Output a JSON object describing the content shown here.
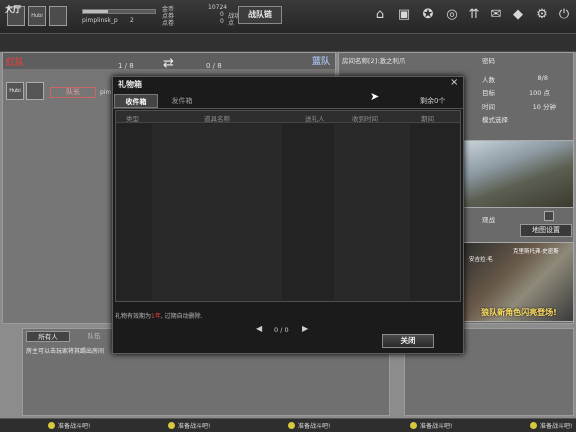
{
  "topbar": {
    "avatar_text": "Hubi",
    "player_name": "pimplinsk_p",
    "level": "2",
    "xp_percent": 0.35,
    "stats_left": [
      "金币",
      "点券",
      "点卷"
    ],
    "stats_right_values": [
      "10724",
      "0",
      "0"
    ],
    "stats_right_labels": [
      "",
      "战功",
      "点"
    ],
    "battle_button": "战队链"
  },
  "hall": {
    "title": "大厅"
  },
  "teams": {
    "red_label": "红队",
    "red_count": "1 / 8",
    "blue_label": "蓝队",
    "blue_count": "0 / 8",
    "slot_avatar": "Hubi",
    "slot_rank": "队长",
    "slot_name": "pim"
  },
  "room": {
    "room_name": "房间名称[2]:激之利爪",
    "password_label": "密码",
    "rows": [
      {
        "label": "人数",
        "value": "8/8"
      },
      {
        "label": "目标",
        "value": "100 点"
      },
      {
        "label": "时间",
        "value": "10 分钟"
      },
      {
        "label": "模式选择",
        "value": ""
      }
    ],
    "observe_label": "观战",
    "map_button": "地图设置"
  },
  "ad": {
    "top_text": "克里斯托弗·史密斯",
    "side_text": "安吉拉·毛",
    "headline": "狼队新角色闪亮登场!"
  },
  "chat": {
    "tab_all": "所有人",
    "tab_team": "队伍",
    "message": "房主可以击玩家将其踢出房间"
  },
  "bottom_status": [
    "准备战斗吧!",
    "准备战斗吧!",
    "准备战斗吧!",
    "准备战斗吧!",
    "准备战斗吧!"
  ],
  "modal": {
    "title": "礼物箱",
    "close_glyph": "×",
    "tab_inbox": "收件箱",
    "tab_sent": "发件箱",
    "remaining": "剩余0个",
    "columns": [
      "类型",
      "道具名称",
      "送礼人",
      "收到时间",
      "期间"
    ],
    "note_prefix": "礼物有效期为",
    "note_highlight": "1年",
    "note_suffix": ", 过期自动删除.",
    "pager_text": "0 / 0",
    "close_button": "关闭"
  },
  "icons": [
    "home-icon",
    "lock-icon",
    "trophy-icon",
    "mail-icon",
    "gift-icon",
    "gear-icon",
    "power-icon"
  ]
}
